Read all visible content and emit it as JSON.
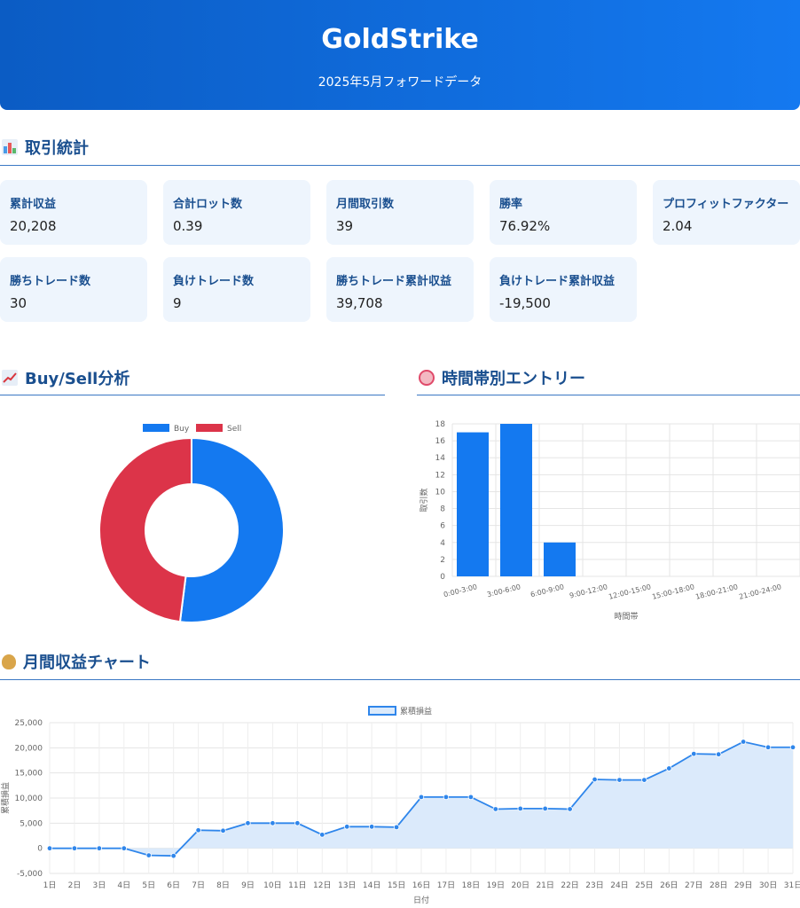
{
  "header": {
    "title": "GoldStrike",
    "subtitle": "2025年5月フォワードデータ"
  },
  "sections": {
    "stats": "取引統計",
    "buysell": "Buy/Sell分析",
    "timezone": "時間帯別エントリー",
    "monthly": "月間収益チャート"
  },
  "cards": [
    {
      "label": "累計収益",
      "value": "20,208"
    },
    {
      "label": "合計ロット数",
      "value": "0.39"
    },
    {
      "label": "月間取引数",
      "value": "39"
    },
    {
      "label": "勝率",
      "value": "76.92%"
    },
    {
      "label": "プロフィットファクター",
      "value": "2.04"
    },
    {
      "label": "勝ちトレード数",
      "value": "30"
    },
    {
      "label": "負けトレード数",
      "value": "9"
    },
    {
      "label": "勝ちトレード累計収益",
      "value": "39,708"
    },
    {
      "label": "負けトレード累計収益",
      "value": "-19,500"
    }
  ],
  "colors": {
    "buy": "#1479f0",
    "sell": "#dc3449",
    "line": "#2f86eb",
    "fill": "#dbeafb",
    "accent": "#1a4f8f"
  },
  "chart_data": [
    {
      "type": "pie",
      "variant": "doughnut",
      "categories": [
        "Buy",
        "Sell"
      ],
      "values": [
        52,
        48
      ],
      "legend": "top"
    },
    {
      "type": "bar",
      "categories": [
        "0:00-3:00",
        "3:00-6:00",
        "6:00-9:00",
        "9:00-12:00",
        "12:00-15:00",
        "15:00-18:00",
        "18:00-21:00",
        "21:00-24:00"
      ],
      "values": [
        17,
        18,
        4,
        0,
        0,
        0,
        0,
        0
      ],
      "xlabel": "時間帯",
      "ylabel": "取引数",
      "ylim": [
        0,
        18
      ],
      "yticks": [
        "0",
        "2",
        "4",
        "6",
        "8",
        "10",
        "12",
        "14",
        "16",
        "18"
      ],
      "grid": true
    },
    {
      "type": "line",
      "series": [
        {
          "name": "累積損益",
          "values": [
            0,
            0,
            0,
            0,
            -1400,
            -1500,
            3600,
            3500,
            5000,
            5000,
            5000,
            2700,
            4300,
            4300,
            4200,
            10200,
            10200,
            10200,
            7800,
            7900,
            7900,
            7800,
            13700,
            13600,
            13600,
            15900,
            18800,
            18700,
            21200,
            20100,
            20100
          ]
        }
      ],
      "x": [
        "1日",
        "2日",
        "3日",
        "4日",
        "5日",
        "6日",
        "7日",
        "8日",
        "9日",
        "10日",
        "11日",
        "12日",
        "13日",
        "14日",
        "15日",
        "16日",
        "17日",
        "18日",
        "19日",
        "20日",
        "21日",
        "22日",
        "23日",
        "24日",
        "25日",
        "26日",
        "27日",
        "28日",
        "29日",
        "30日",
        "31日"
      ],
      "xlabel": "日付",
      "ylabel": "累積損益",
      "ylim": [
        -5000,
        25000
      ],
      "yticks": [
        "-5,000",
        "0",
        "5,000",
        "10,000",
        "15,000",
        "20,000",
        "25,000"
      ],
      "legend": "top",
      "grid": true
    }
  ]
}
